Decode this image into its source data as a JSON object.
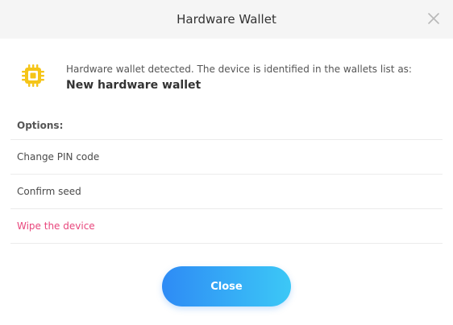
{
  "dialog": {
    "title": "Hardware Wallet",
    "close_icon": "close-icon"
  },
  "info": {
    "icon": "chip-icon",
    "message": "Hardware wallet detected. The device is identified in the wallets list as:",
    "wallet_name": "New hardware wallet"
  },
  "options": {
    "label": "Options:",
    "items": [
      {
        "label": "Change PIN code"
      },
      {
        "label": "Confirm seed"
      },
      {
        "label": "Wipe the device"
      }
    ]
  },
  "footer": {
    "close_label": "Close"
  },
  "colors": {
    "accent_gradient_start": "#2e8bf5",
    "accent_gradient_end": "#3cc8f6",
    "danger": "#e8467c",
    "chip_icon": "#f5c518"
  }
}
